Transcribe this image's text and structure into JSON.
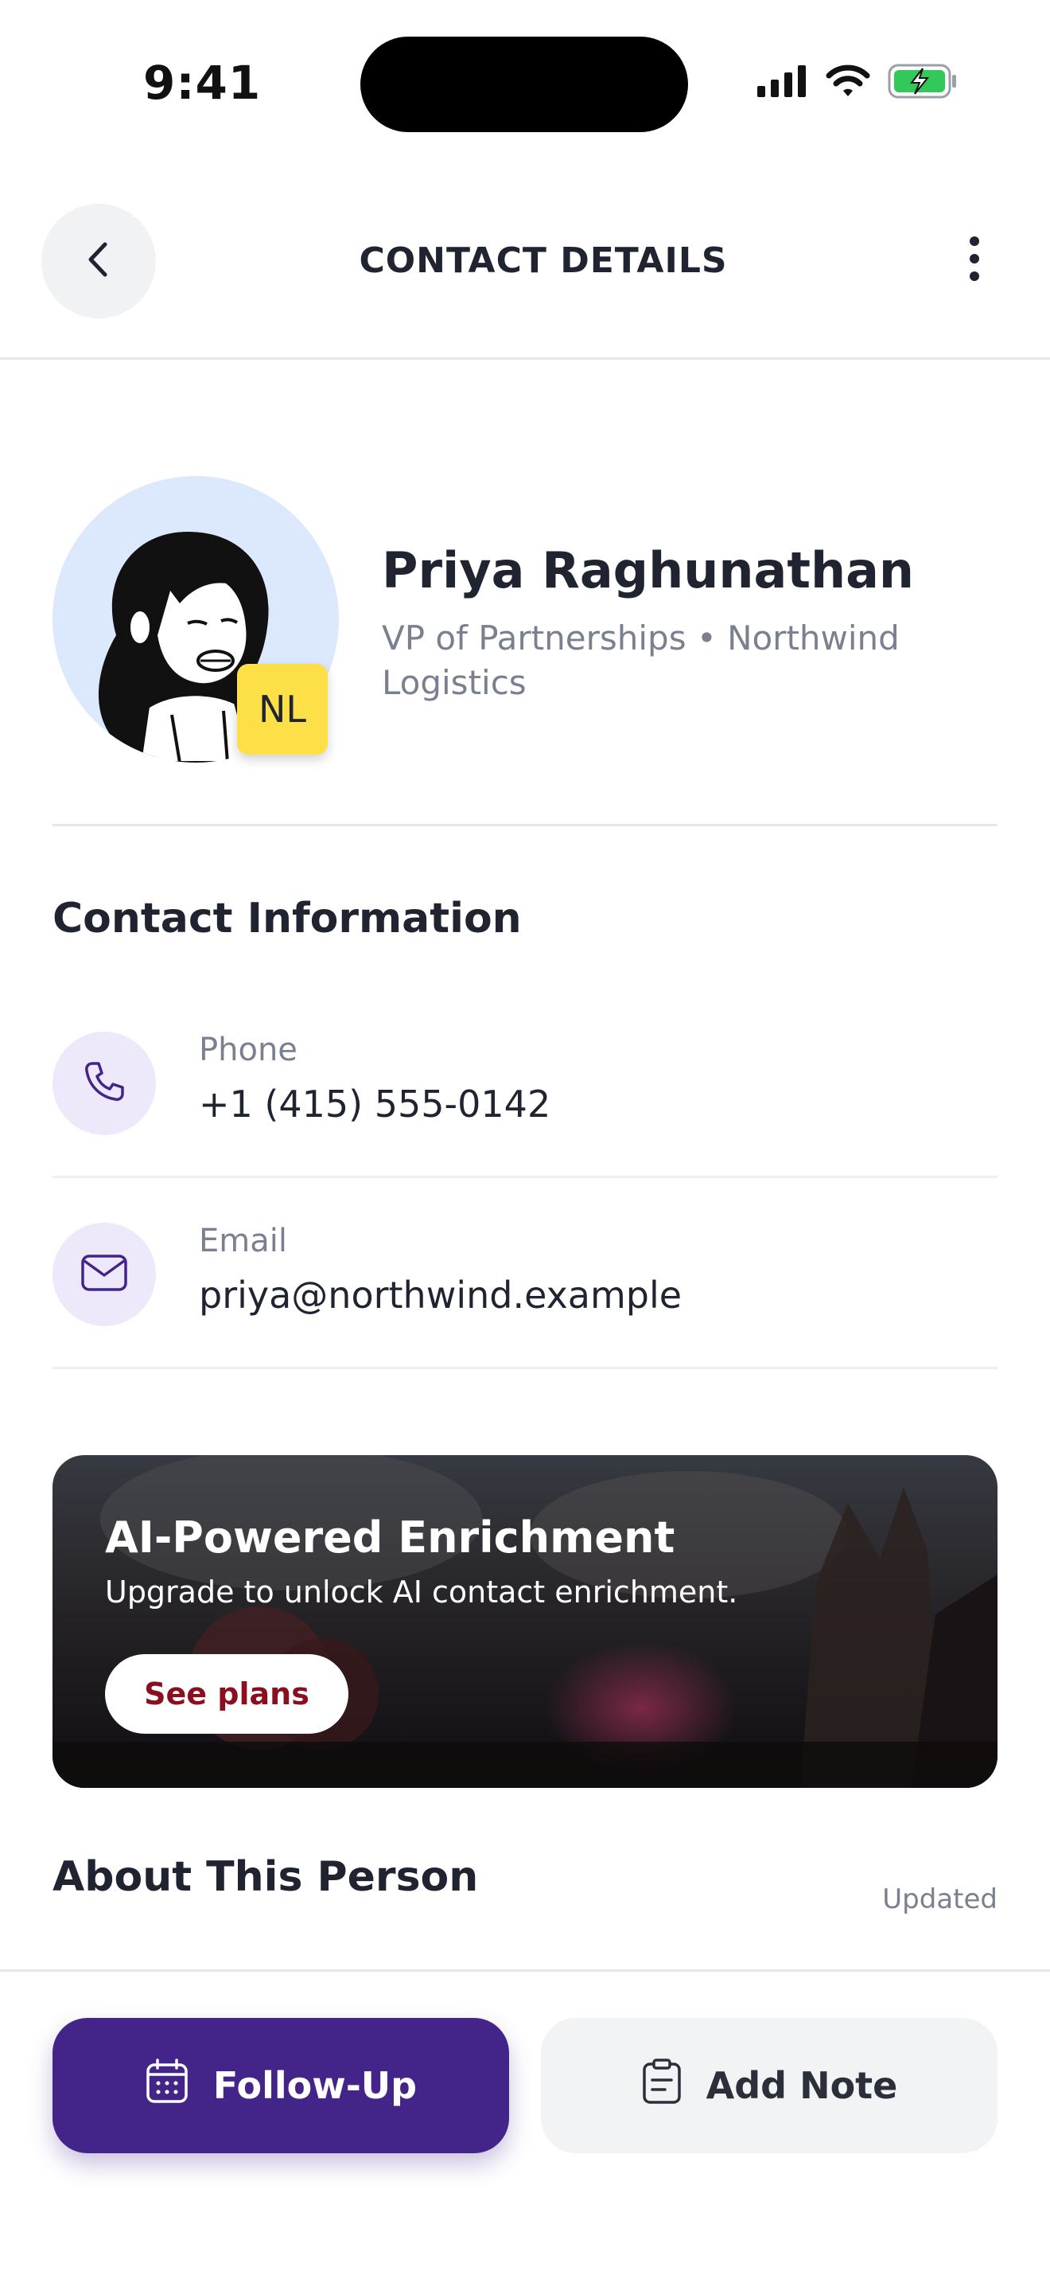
{
  "status_bar": {
    "time": "9:41",
    "icons": [
      "signal-icon",
      "wifi-icon",
      "battery-charging-icon"
    ],
    "battery_color": "#34c759"
  },
  "header": {
    "title": "CONTACT DETAILS",
    "back_icon": "chevron-left-icon",
    "more_icon": "more-vertical-icon"
  },
  "profile": {
    "name": "Priya Raghunathan",
    "role": "VP of Partnerships • Northwind Logistics",
    "badge": "NL",
    "badge_color": "#fde047",
    "avatar_bg": "#dce8fb"
  },
  "contact_info": {
    "title": "Contact Information",
    "items": [
      {
        "icon": "phone-icon",
        "label": "Phone",
        "value": "+1 (415) 555-0142"
      },
      {
        "icon": "mail-icon",
        "label": "Email",
        "value": "priya@northwind.example"
      }
    ]
  },
  "promo": {
    "title": "AI-Powered Enrichment",
    "subtitle": "Upgrade to unlock AI contact enrichment.",
    "button_label": "See plans",
    "button_text_color": "#8a1020"
  },
  "about": {
    "title": "About This Person",
    "updated_label": "Updated"
  },
  "actions": {
    "primary": {
      "label": "Follow-Up",
      "icon": "calendar-icon",
      "color": "#432589"
    },
    "secondary": {
      "label": "Add Note",
      "icon": "note-icon"
    }
  }
}
